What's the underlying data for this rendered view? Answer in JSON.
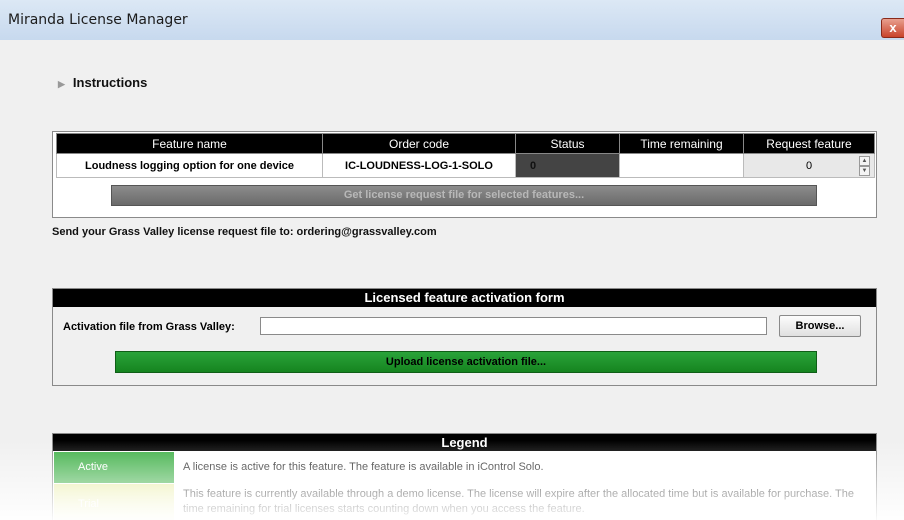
{
  "window": {
    "title": "Miranda License Manager",
    "close_label": "x"
  },
  "instructions": {
    "label": "Instructions"
  },
  "feature_table": {
    "columns": [
      "Feature name",
      "Order code",
      "Status",
      "Time remaining",
      "Request feature"
    ],
    "rows": [
      {
        "feature_name": "Loudness logging option for one device",
        "order_code": "IC-LOUDNESS-LOG-1-SOLO",
        "status": "0",
        "time_remaining": "",
        "request_feature": "0"
      }
    ],
    "get_button": "Get license request file for selected features..."
  },
  "send_text": "Send your Grass Valley license request file to: ordering@grassvalley.com",
  "activation": {
    "header": "Licensed feature activation form",
    "file_label": "Activation file from Grass Valley:",
    "file_value": "",
    "browse_button": "Browse...",
    "upload_button": "Upload license activation file..."
  },
  "legend": {
    "header": "Legend",
    "items": [
      {
        "name": "Active",
        "color": "#3caf45",
        "description": "A license is active for this feature. The feature is available in iControl Solo."
      },
      {
        "name": "Trial",
        "color": "#e8eba0",
        "description": "This feature is currently available through a demo license. The license will expire after the allocated time but is available for purchase. The time remaining for trial licenses starts counting down when you access the feature."
      }
    ]
  }
}
